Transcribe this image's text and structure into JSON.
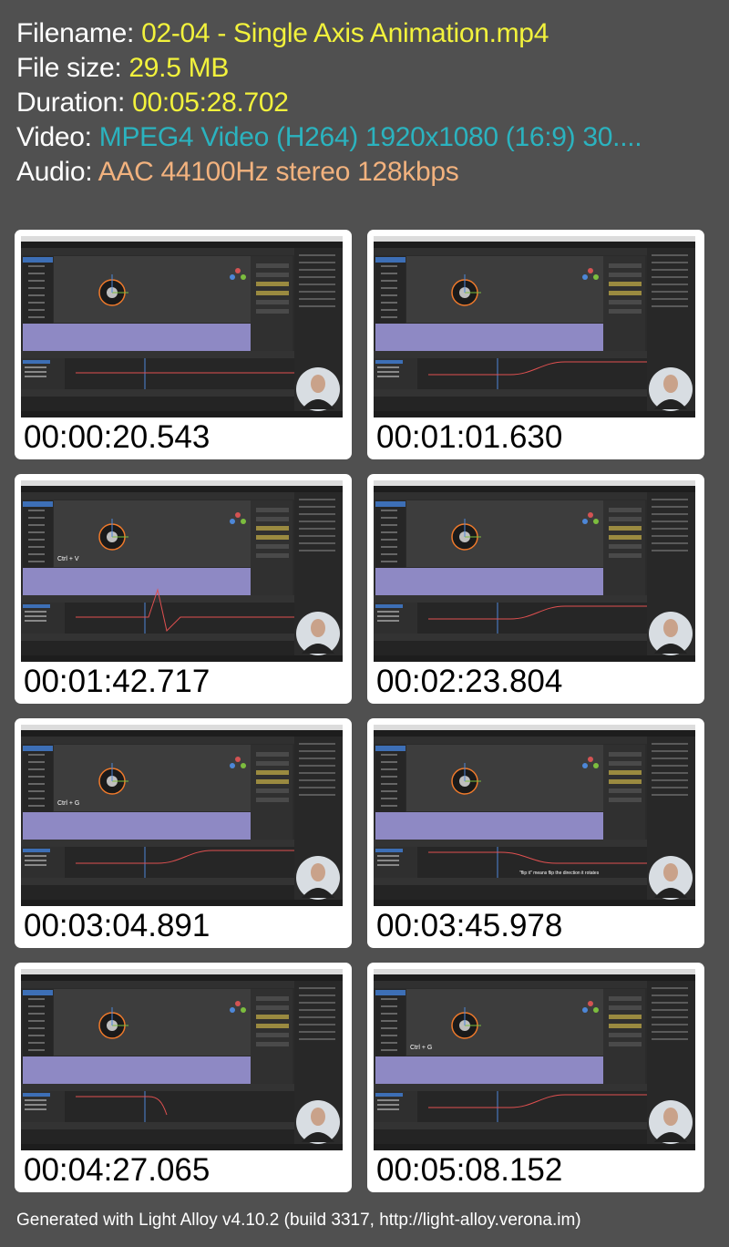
{
  "file_info": {
    "filename_label": "Filename: ",
    "filename": "02-04 - Single Axis Animation.mp4",
    "filesize_label": "File size: ",
    "filesize": "29.5 MB",
    "duration_label": "Duration: ",
    "duration": "00:05:28.702",
    "video_label": "Video: ",
    "video": "MPEG4 Video (H264) 1920x1080 (16:9) 30....",
    "audio_label": "Audio: ",
    "audio": "AAC 44100Hz stereo 128kbps"
  },
  "thumbnails": [
    {
      "timestamp": "00:00:20.543",
      "curve": "flat"
    },
    {
      "timestamp": "00:01:01.630",
      "curve": "ease"
    },
    {
      "timestamp": "00:01:42.717",
      "curve": "spike",
      "overlay": "Ctrl + V"
    },
    {
      "timestamp": "00:02:23.804",
      "curve": "ease"
    },
    {
      "timestamp": "00:03:04.891",
      "curve": "ease",
      "overlay": "Ctrl + G"
    },
    {
      "timestamp": "00:03:45.978",
      "curve": "descend",
      "overlay": "\"flip it\" means flip the direction it rotates"
    },
    {
      "timestamp": "00:04:27.065",
      "curve": "drop"
    },
    {
      "timestamp": "00:05:08.152",
      "curve": "ease",
      "overlay": "Ctrl + G"
    }
  ],
  "colors": {
    "background": "#505050",
    "filename": "#f2f23c",
    "video": "#2bb3bf",
    "audio": "#f2b27e"
  },
  "footer": "Generated with Light Alloy v4.10.2 (build 3317, http://light-alloy.verona.im)"
}
